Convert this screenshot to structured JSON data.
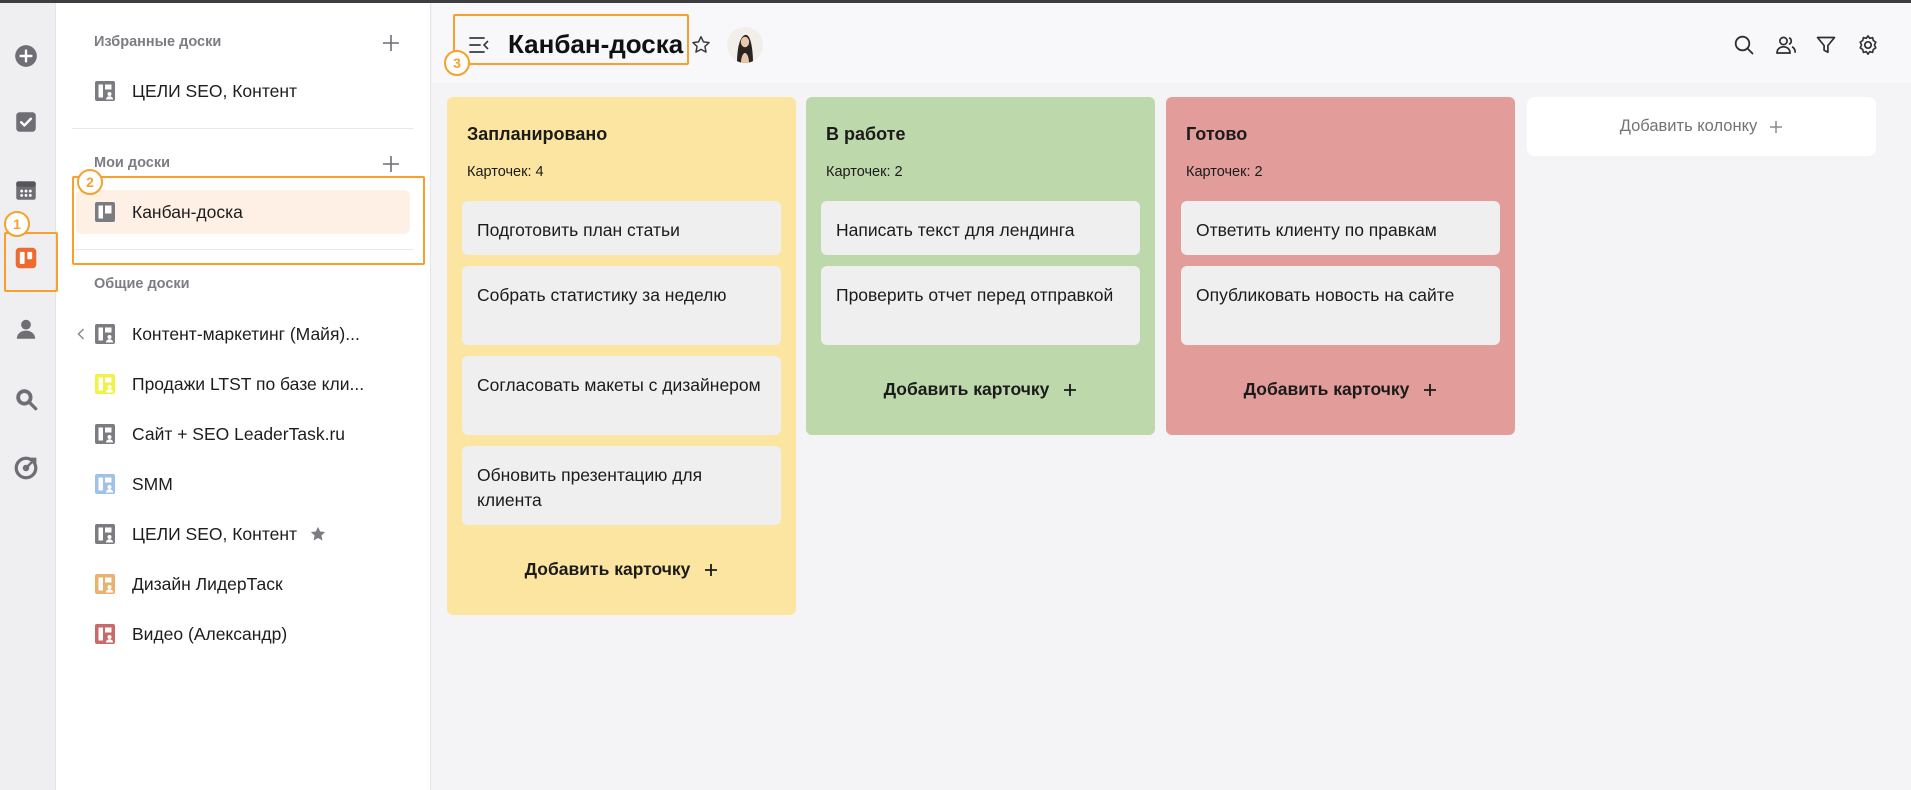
{
  "rail": {
    "items": [
      {
        "icon": "plus-circle-icon"
      },
      {
        "icon": "check-square-icon"
      },
      {
        "icon": "calendar-icon"
      },
      {
        "icon": "kanban-board-icon",
        "active": true
      },
      {
        "icon": "user-icon"
      },
      {
        "icon": "search-doc-icon"
      },
      {
        "icon": "target-icon"
      }
    ]
  },
  "sidebar": {
    "favorites": {
      "title": "Избранные доски",
      "items": [
        {
          "label": "ЦЕЛИ SEO, Контент",
          "color": "#7b7b82"
        }
      ]
    },
    "my_boards": {
      "title": "Мои доски",
      "items": [
        {
          "label": "Канбан-доска",
          "color": "#7b7b82",
          "active": true
        }
      ]
    },
    "shared": {
      "title": "Общие доски",
      "items": [
        {
          "label": "Контент-маркетинг (Майя)...",
          "color": "#7b7b82"
        },
        {
          "label": "Продажи LTST по базе кли...",
          "color": "#f2f246"
        },
        {
          "label": "Сайт + SEO LeaderTask.ru",
          "color": "#7b7b82"
        },
        {
          "label": "SMM",
          "color": "#9ec2e8"
        },
        {
          "label": "ЦЕЛИ SEO, Контент",
          "color": "#7b7b82",
          "starred": true
        },
        {
          "label": "Дизайн ЛидерТаск",
          "color": "#e8b271"
        },
        {
          "label": "Видео (Александр)",
          "color": "#c96a6a"
        }
      ]
    }
  },
  "header": {
    "title": "Канбан-доска"
  },
  "columns": [
    {
      "title": "Запланировано",
      "count_label": "Карточек: 4",
      "color": "#fbe5a0",
      "cards": [
        "Подготовить план статьи",
        "Собрать статистику за неделю",
        "Согласовать макеты с дизайнером",
        "Обновить презентацию для клиента"
      ],
      "add_label": "Добавить карточку"
    },
    {
      "title": "В работе",
      "count_label": "Карточек: 2",
      "color": "#bdd9ac",
      "cards": [
        "Написать текст для лендинга",
        "Проверить отчет перед отправкой"
      ],
      "add_label": "Добавить карточку"
    },
    {
      "title": "Готово",
      "count_label": "Карточек: 2",
      "color": "#e29d9a",
      "cards": [
        "Ответить клиенту по правкам",
        "Опубликовать новость на сайте"
      ],
      "add_label": "Добавить карточку"
    }
  ],
  "add_column_label": "Добавить колонку",
  "callouts": [
    "1",
    "2",
    "3"
  ],
  "colors": {
    "accent": "#f7a12c",
    "active_item_bg": "#fff0e6",
    "rail_active_icon": "#ef6a2f"
  }
}
